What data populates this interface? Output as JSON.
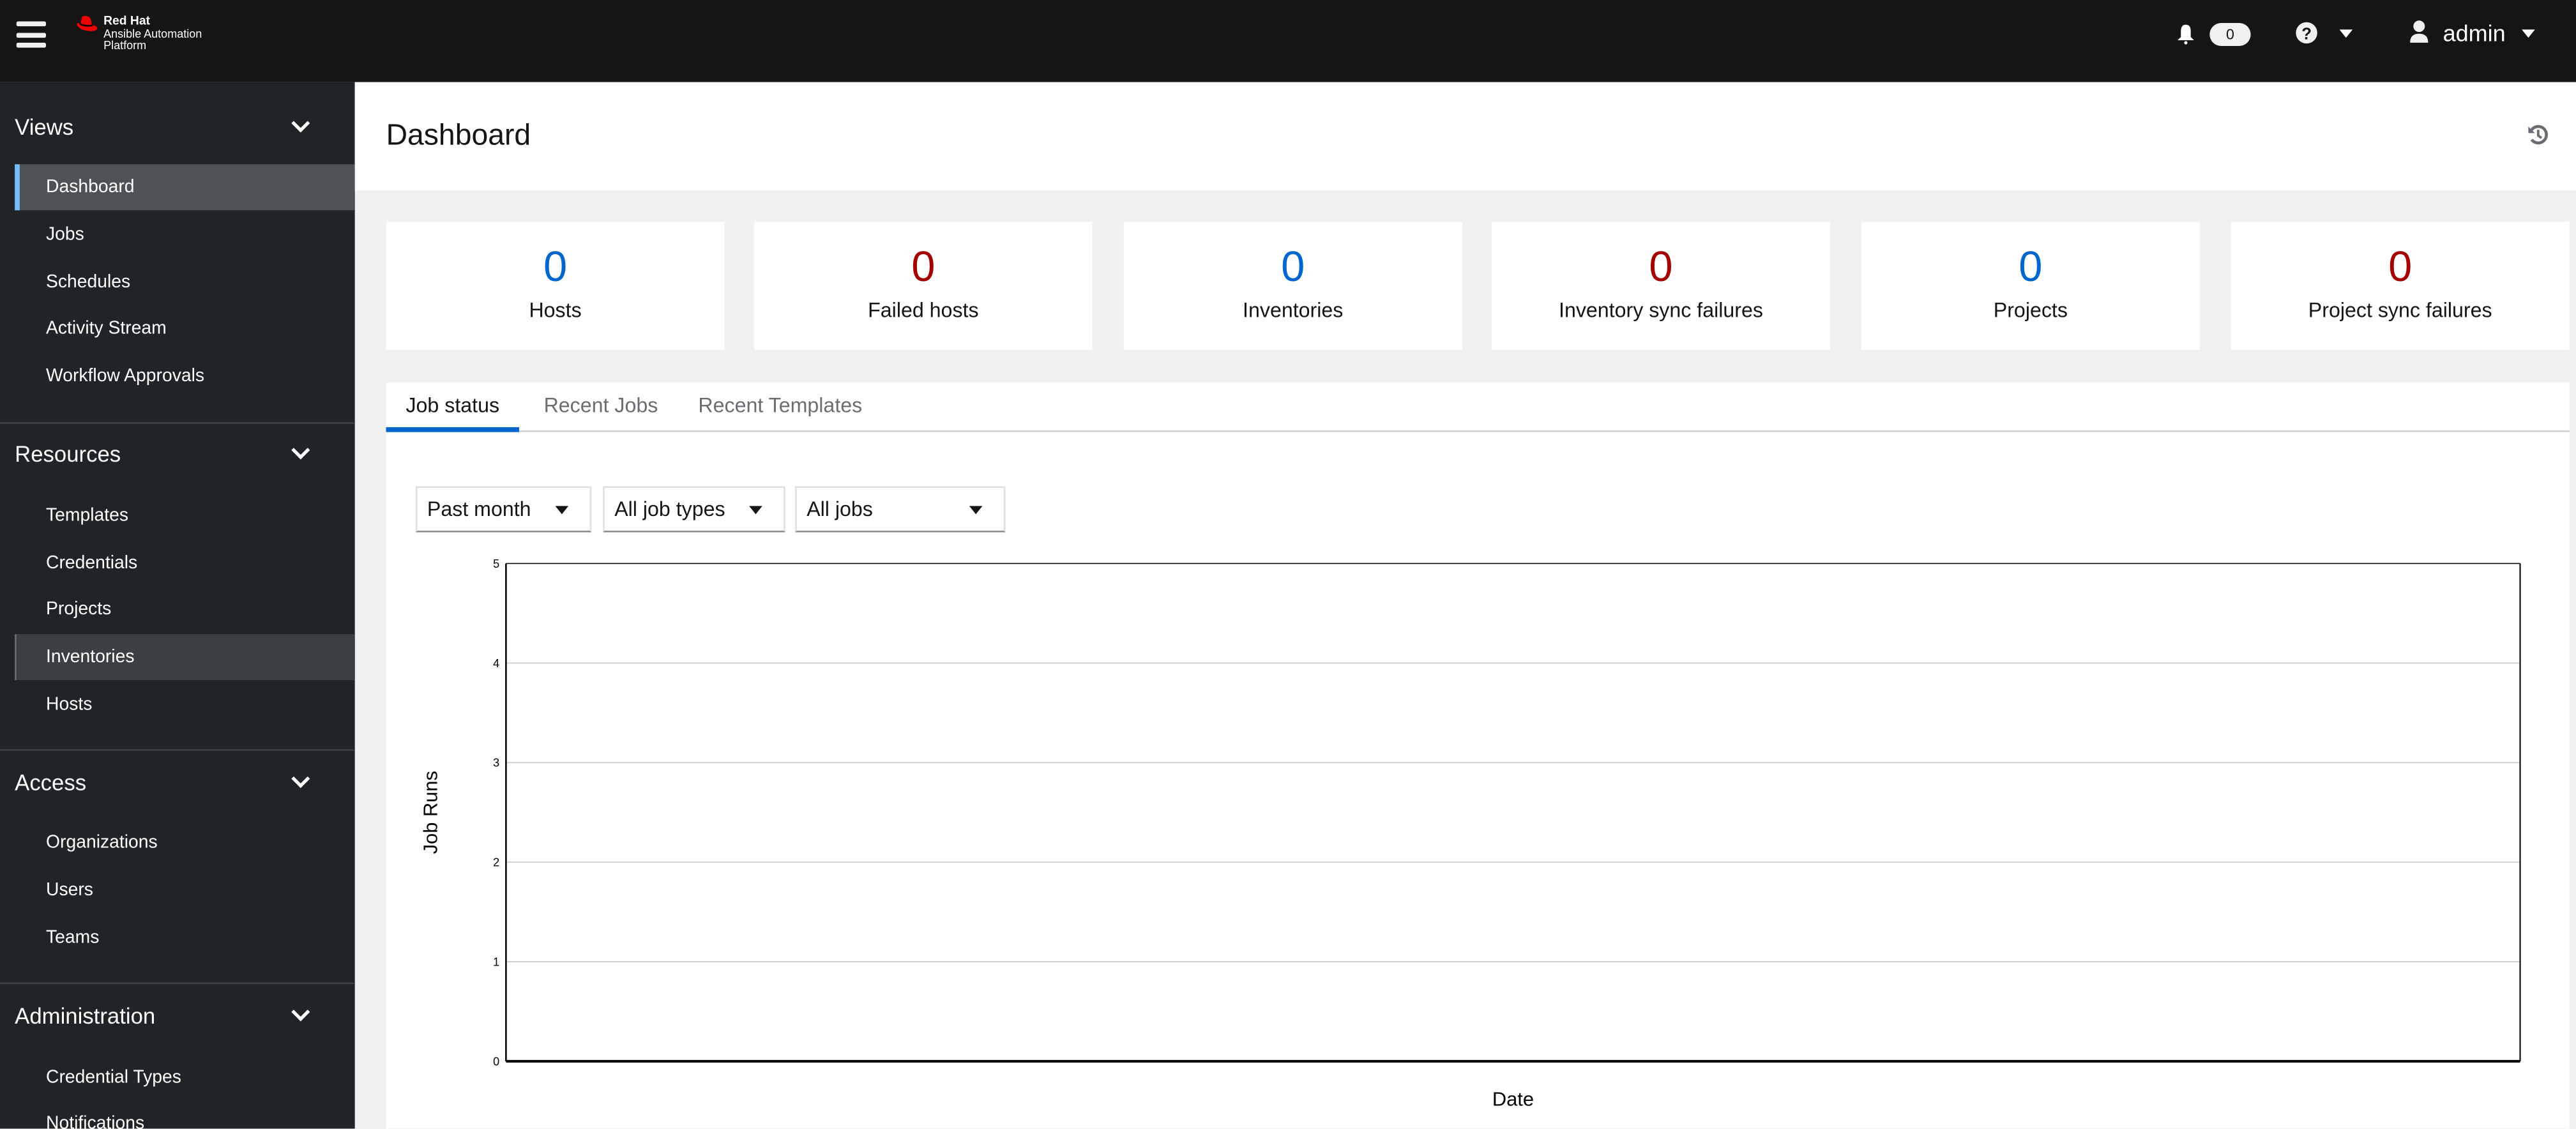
{
  "header": {
    "logo_line1": "Red Hat",
    "logo_line2": "Ansible Automation",
    "logo_line3": "Platform",
    "notification_count": "0",
    "username": "admin"
  },
  "sidebar": {
    "groups": [
      {
        "label": "Views",
        "items": [
          "Dashboard",
          "Jobs",
          "Schedules",
          "Activity Stream",
          "Workflow Approvals"
        ]
      },
      {
        "label": "Resources",
        "items": [
          "Templates",
          "Credentials",
          "Projects",
          "Inventories",
          "Hosts"
        ]
      },
      {
        "label": "Access",
        "items": [
          "Organizations",
          "Users",
          "Teams"
        ]
      },
      {
        "label": "Administration",
        "items": [
          "Credential Types",
          "Notifications"
        ]
      }
    ],
    "active": "Dashboard",
    "hovered": "Inventories"
  },
  "page": {
    "title": "Dashboard"
  },
  "cards": [
    {
      "value": "0",
      "label": "Hosts",
      "color": "#0066cc"
    },
    {
      "value": "0",
      "label": "Failed hosts",
      "color": "#a30000"
    },
    {
      "value": "0",
      "label": "Inventories",
      "color": "#0066cc"
    },
    {
      "value": "0",
      "label": "Inventory sync failures",
      "color": "#a30000"
    },
    {
      "value": "0",
      "label": "Projects",
      "color": "#0066cc"
    },
    {
      "value": "0",
      "label": "Project sync failures",
      "color": "#a30000"
    }
  ],
  "tabs": [
    "Job status",
    "Recent Jobs",
    "Recent Templates"
  ],
  "filters": {
    "period": "Past month",
    "job_type": "All job types",
    "jobs": "All jobs"
  },
  "chart_data": {
    "type": "line",
    "xlabel": "Date",
    "ylabel": "Job Runs",
    "ylim": [
      0,
      5
    ],
    "yticks": [
      "0",
      "1",
      "2",
      "3",
      "4",
      "5"
    ],
    "grid": true,
    "series": []
  }
}
